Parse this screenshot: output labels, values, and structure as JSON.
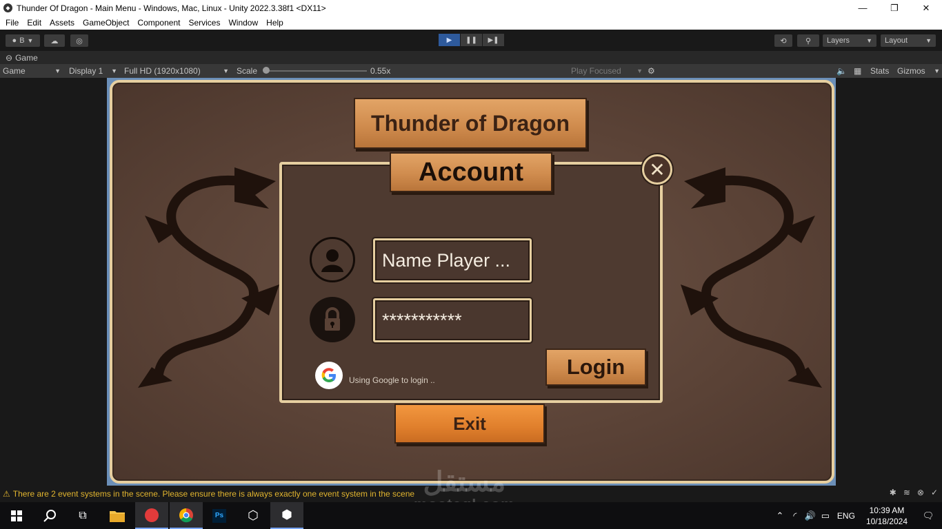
{
  "window": {
    "title": "Thunder Of Dragon - Main Menu - Windows, Mac, Linux - Unity 2022.3.38f1 <DX11>"
  },
  "menu": [
    "File",
    "Edit",
    "Assets",
    "GameObject",
    "Component",
    "Services",
    "Window",
    "Help"
  ],
  "toolbar": {
    "account_label": "B",
    "layers_label": "Layers",
    "layout_label": "Layout"
  },
  "game_panel": {
    "tab_label": "Game",
    "view_select": "Game",
    "display_select": "Display 1",
    "resolution_select": "Full HD (1920x1080)",
    "scale_label": "Scale",
    "scale_value": "0.55x",
    "play_focused": "Play Focused",
    "stats_label": "Stats",
    "gizmos_label": "Gizmos"
  },
  "game": {
    "title": "Thunder of Dragon",
    "account_title": "Account",
    "name_field_value": "Name Player ...",
    "password_field_value": "***********",
    "login_label": "Login",
    "google_text": "Using Google to login ..",
    "exit_label": "Exit"
  },
  "status": {
    "warning": "There are 2 event systems in the scene. Please ensure there is always exactly one event system in the scene"
  },
  "watermark": {
    "arabic": "مستقل",
    "site": "mostaql.com"
  },
  "taskbar": {
    "language": "ENG",
    "time": "10:39 AM",
    "date": "10/18/2024"
  },
  "colors": {
    "frame_gold": "#e6cfa0",
    "wood_orange": "#e07f2c",
    "panel_brown": "#4e3a30",
    "warning_yellow": "#e2b52f",
    "play_active": "#2e5a9c"
  }
}
